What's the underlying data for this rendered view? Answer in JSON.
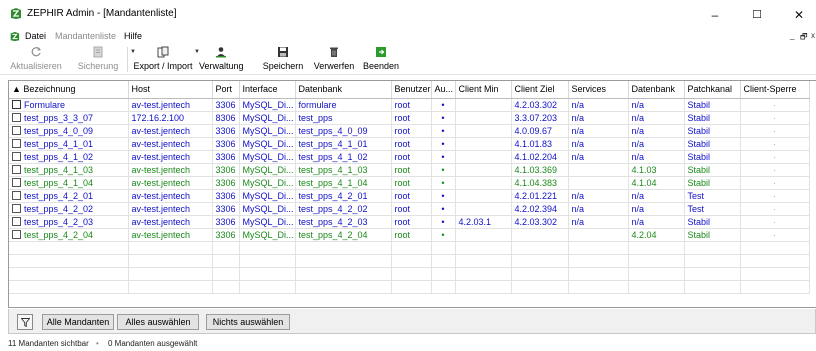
{
  "window": {
    "title": "ZEPHIR Admin - [Mandantenliste]",
    "minimize": "–",
    "maximize": "☐",
    "close": "✕"
  },
  "menu": {
    "items": [
      "Datei",
      "Mandantenliste",
      "Hilfe"
    ],
    "mdi_min": "_",
    "mdi_restore": "🗗",
    "mdi_close": "x"
  },
  "toolbar": {
    "refresh": "Aktualisieren",
    "backup": "Sicherung",
    "export_import": "Export / Import",
    "manage": "Verwaltung",
    "save": "Speichern",
    "discard": "Verwerfen",
    "quit": "Beenden"
  },
  "grid": {
    "columns": [
      "▲ Bezeichnung",
      "Host",
      "Port",
      "Interface",
      "Datenbank",
      "Benutzer",
      "Au...",
      "Client Min",
      "Client Ziel",
      "Services",
      "Datenbank",
      "Patchkanal",
      "Client-Sperre"
    ],
    "rows": [
      {
        "name": "Formulare",
        "host": "av-test.jentech",
        "port": "3306",
        "iface": "MySQL_Di...",
        "db": "formulare",
        "user": "root",
        "auto": "•",
        "cmin": "",
        "cziel": "4.2.03.302",
        "services": "n/a",
        "db2": "n/a",
        "kanal": "Stabil",
        "sperre": "·",
        "color": "blue",
        "checkbox": false
      },
      {
        "name": "test_pps_3_3_07",
        "host": "172.16.2.100",
        "port": "8306",
        "iface": "MySQL_Di...",
        "db": "test_pps",
        "user": "root",
        "auto": "•",
        "cmin": "",
        "cziel": "3.3.07.203",
        "services": "n/a",
        "db2": "n/a",
        "kanal": "Stabil",
        "sperre": "·",
        "color": "blue",
        "checkbox": true
      },
      {
        "name": "test_pps_4_0_09",
        "host": "av-test.jentech",
        "port": "3306",
        "iface": "MySQL_Di...",
        "db": "test_pps_4_0_09",
        "user": "root",
        "auto": "•",
        "cmin": "",
        "cziel": "4.0.09.67",
        "services": "n/a",
        "db2": "n/a",
        "kanal": "Stabil",
        "sperre": "·",
        "color": "blue",
        "checkbox": true
      },
      {
        "name": "test_pps_4_1_01",
        "host": "av-test.jentech",
        "port": "3306",
        "iface": "MySQL_Di...",
        "db": "test_pps_4_1_01",
        "user": "root",
        "auto": "•",
        "cmin": "",
        "cziel": "4.1.01.83",
        "services": "n/a",
        "db2": "n/a",
        "kanal": "Stabil",
        "sperre": "·",
        "color": "blue",
        "checkbox": true
      },
      {
        "name": "test_pps_4_1_02",
        "host": "av-test.jentech",
        "port": "3306",
        "iface": "MySQL_Di...",
        "db": "test_pps_4_1_02",
        "user": "root",
        "auto": "•",
        "cmin": "",
        "cziel": "4.1.02.204",
        "services": "n/a",
        "db2": "n/a",
        "kanal": "Stabil",
        "sperre": "·",
        "color": "blue",
        "checkbox": true
      },
      {
        "name": "test_pps_4_1_03",
        "host": "av-test.jentech",
        "port": "3306",
        "iface": "MySQL_Di...",
        "db": "test_pps_4_1_03",
        "user": "root",
        "auto": "•",
        "cmin": "",
        "cziel": "4.1.03.369",
        "services": "",
        "db2": "4.1.03",
        "kanal": "Stabil",
        "sperre": "·",
        "color": "green",
        "checkbox": true
      },
      {
        "name": "test_pps_4_1_04",
        "host": "av-test.jentech",
        "port": "3306",
        "iface": "MySQL_Di...",
        "db": "test_pps_4_1_04",
        "user": "root",
        "auto": "•",
        "cmin": "",
        "cziel": "4.1.04.383",
        "services": "",
        "db2": "4.1.04",
        "kanal": "Stabil",
        "sperre": "·",
        "color": "green",
        "checkbox": true
      },
      {
        "name": "test_pps_4_2_01",
        "host": "av-test.jentech",
        "port": "3306",
        "iface": "MySQL_Di...",
        "db": "test_pps_4_2_01",
        "user": "root",
        "auto": "•",
        "cmin": "",
        "cziel": "4.2.01.221",
        "services": "n/a",
        "db2": "n/a",
        "kanal": "Test",
        "sperre": "·",
        "color": "blue",
        "checkbox": true
      },
      {
        "name": "test_pps_4_2_02",
        "host": "av-test.jentech",
        "port": "3306",
        "iface": "MySQL_Di...",
        "db": "test_pps_4_2_02",
        "user": "root",
        "auto": "•",
        "cmin": "",
        "cziel": "4.2.02.394",
        "services": "n/a",
        "db2": "n/a",
        "kanal": "Test",
        "sperre": "·",
        "color": "blue",
        "checkbox": true
      },
      {
        "name": "test_pps_4_2_03",
        "host": "av-test.jentech",
        "port": "3306",
        "iface": "MySQL_Di...",
        "db": "test_pps_4_2_03",
        "user": "root",
        "auto": "•",
        "cmin": "4.2.03.1",
        "cziel": "4.2.03.302",
        "services": "n/a",
        "db2": "n/a",
        "kanal": "Stabil",
        "sperre": "·",
        "color": "blue",
        "checkbox": true
      },
      {
        "name": "test_pps_4_2_04",
        "host": "av-test.jentech",
        "port": "3306",
        "iface": "MySQL_Di...",
        "db": "test_pps_4_2_04",
        "user": "root",
        "auto": "•",
        "cmin": "",
        "cziel": "",
        "services": "",
        "db2": "4.2.04",
        "kanal": "Stabil",
        "sperre": "·",
        "color": "green",
        "checkbox": true
      }
    ]
  },
  "bottom": {
    "all_clients": "Alle Mandanten",
    "select_all": "Alles auswählen",
    "select_none": "Nichts auswählen"
  },
  "status": {
    "visible": "11 Mandanten sichtbar",
    "separator": "•",
    "selected": "0 Mandanten ausgewählt"
  },
  "colors": {
    "blue_row": "#1010c8",
    "green_row": "#1a8a1a",
    "app_icon": "#2e8b2e"
  }
}
